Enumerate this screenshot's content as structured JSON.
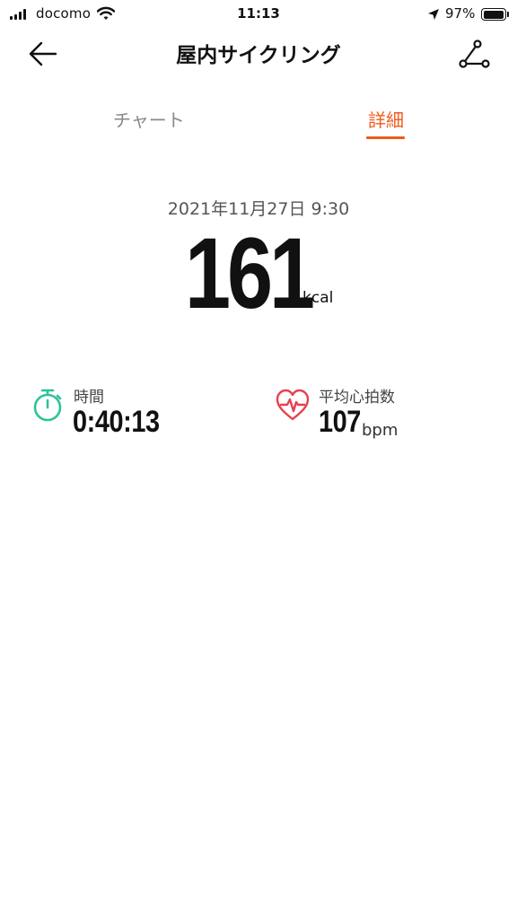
{
  "status_bar": {
    "carrier": "docomo",
    "time": "11:13",
    "battery_percent": "97%",
    "battery_level": 0.97
  },
  "nav": {
    "title": "屋内サイクリング",
    "back_icon": "arrow-left-icon",
    "route_icon": "route-icon"
  },
  "tabs": [
    {
      "label": "チャート",
      "active": false
    },
    {
      "label": "詳細",
      "active": true
    }
  ],
  "summary": {
    "datetime": "2021年11月27日 9:30",
    "calories": "161",
    "calories_unit": "kcal"
  },
  "metrics": {
    "duration": {
      "label": "時間",
      "value": "0:40:13",
      "icon": "stopwatch-icon"
    },
    "heart_rate": {
      "label": "平均心拍数",
      "value": "107",
      "unit": "bpm",
      "icon": "heart-rate-icon"
    }
  },
  "colors": {
    "accent": "#f05a1c",
    "timer_icon": "#2ec39a",
    "heart_icon": "#e8404f"
  }
}
